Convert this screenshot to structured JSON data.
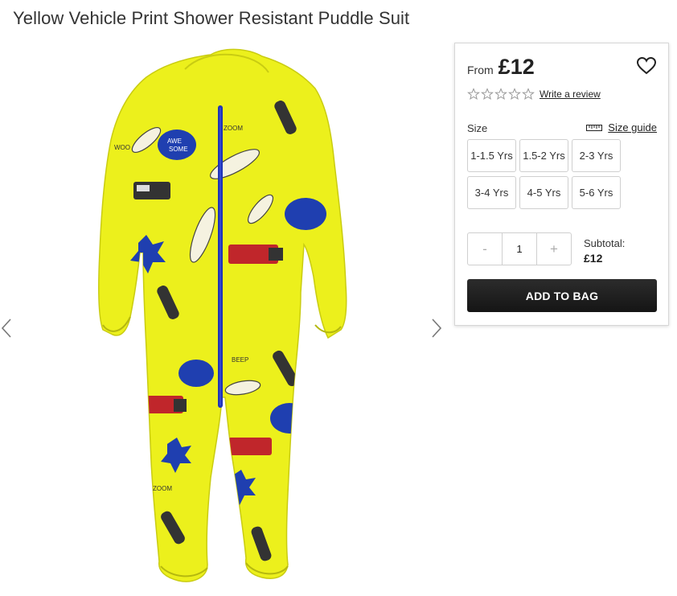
{
  "product": {
    "title": "Yellow Vehicle Print Shower Resistant Puddle Suit",
    "image_description": "Yellow puddle suit with vehicle print and blue zip"
  },
  "gallery": {
    "prev_icon": "chevron-left-icon",
    "next_icon": "chevron-right-icon"
  },
  "panel": {
    "price_prefix": "From",
    "price": "£12",
    "wishlist_icon": "heart-icon",
    "rating": {
      "stars_filled": 0,
      "stars_total": 5,
      "review_link": "Write a review"
    },
    "size_label": "Size",
    "size_guide_label": "Size guide",
    "sizes": [
      "1-1.5 Yrs",
      "1.5-2 Yrs",
      "2-3 Yrs",
      "3-4 Yrs",
      "4-5 Yrs",
      "5-6 Yrs"
    ],
    "quantity": {
      "minus": "-",
      "value": "1",
      "plus": "+"
    },
    "subtotal_label": "Subtotal:",
    "subtotal_value": "£12",
    "add_to_bag": "ADD TO BAG"
  },
  "colors": {
    "suit_yellow": "#eef11c",
    "zip_blue": "#1f34b8",
    "button_dark": "#1c1c1c"
  }
}
